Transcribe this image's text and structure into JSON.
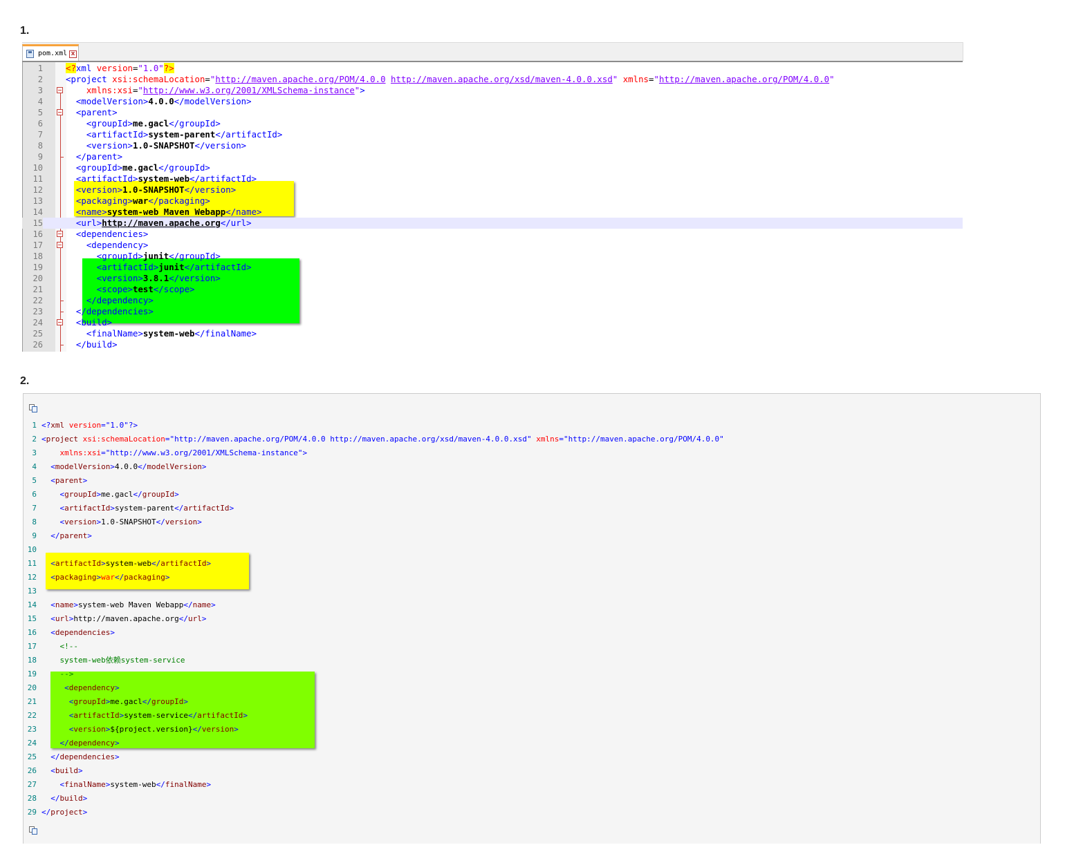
{
  "section1": {
    "heading": "1."
  },
  "section2": {
    "heading": "2."
  },
  "editor": {
    "tab_label": "pom.xml",
    "tab_close": "x",
    "line_numbers": [
      "1",
      "2",
      "3",
      "4",
      "5",
      "6",
      "7",
      "8",
      "9",
      "10",
      "11",
      "12",
      "13",
      "14",
      "15",
      "16",
      "17",
      "18",
      "19",
      "20",
      "21",
      "22",
      "23",
      "24",
      "25",
      "26"
    ],
    "current_line": 15,
    "lines": [
      [
        [
          "x-pi",
          "<?"
        ],
        [
          "x-tag",
          "xml "
        ],
        [
          "x-attr",
          "version"
        ],
        [
          "",
          "="
        ],
        [
          "x-val",
          "\"1.0\""
        ],
        [
          "x-pi",
          "?>"
        ]
      ],
      [
        [
          "x-tag",
          "<project "
        ],
        [
          "x-attr",
          "xsi:schemaLocation"
        ],
        [
          "",
          "="
        ],
        [
          "x-val",
          "\""
        ],
        [
          "x-url",
          "http://maven.apache.org/POM/4.0.0"
        ],
        [
          "x-val",
          " "
        ],
        [
          "x-url",
          "http://maven.apache.org/xsd/maven-4.0.0.xsd"
        ],
        [
          "x-val",
          "\" "
        ],
        [
          "x-attr",
          "xmlns"
        ],
        [
          "",
          "="
        ],
        [
          "x-val",
          "\""
        ],
        [
          "x-url",
          "http://maven.apache.org/POM/4.0.0"
        ],
        [
          "x-val",
          "\""
        ]
      ],
      [
        [
          "",
          "    "
        ],
        [
          "x-attr",
          "xmlns:xsi"
        ],
        [
          "",
          "="
        ],
        [
          "x-val",
          "\""
        ],
        [
          "x-url",
          "http://www.w3.org/2001/XMLSchema-instance"
        ],
        [
          "x-val",
          "\""
        ],
        [
          "x-tag",
          ">"
        ]
      ],
      [
        [
          "",
          "  "
        ],
        [
          "x-tag",
          "<modelVersion>"
        ],
        [
          "x-txt",
          "4.0.0"
        ],
        [
          "x-tag",
          "</modelVersion>"
        ]
      ],
      [
        [
          "",
          "  "
        ],
        [
          "x-tag",
          "<parent>"
        ]
      ],
      [
        [
          "",
          "    "
        ],
        [
          "x-tag",
          "<groupId>"
        ],
        [
          "x-txt",
          "me.gacl"
        ],
        [
          "x-tag",
          "</groupId>"
        ]
      ],
      [
        [
          "",
          "    "
        ],
        [
          "x-tag",
          "<artifactId>"
        ],
        [
          "x-txt",
          "system-parent"
        ],
        [
          "x-tag",
          "</artifactId>"
        ]
      ],
      [
        [
          "",
          "    "
        ],
        [
          "x-tag",
          "<version>"
        ],
        [
          "x-txt",
          "1.0-SNAPSHOT"
        ],
        [
          "x-tag",
          "</version>"
        ]
      ],
      [
        [
          "",
          "  "
        ],
        [
          "x-tag",
          "</parent>"
        ]
      ],
      [
        [
          "",
          "  "
        ],
        [
          "x-tag",
          "<groupId>"
        ],
        [
          "x-txt",
          "me.gacl"
        ],
        [
          "x-tag",
          "</groupId>"
        ]
      ],
      [
        [
          "",
          "  "
        ],
        [
          "x-tag",
          "<artifactId>"
        ],
        [
          "x-txt",
          "system-web"
        ],
        [
          "x-tag",
          "</artifactId>"
        ]
      ],
      [
        [
          "",
          "  "
        ],
        [
          "x-tag",
          "<version>"
        ],
        [
          "x-txt",
          "1.0-SNAPSHOT"
        ],
        [
          "x-tag",
          "</version>"
        ]
      ],
      [
        [
          "",
          "  "
        ],
        [
          "x-tag",
          "<packaging>"
        ],
        [
          "x-txt",
          "war"
        ],
        [
          "x-tag",
          "</packaging>"
        ]
      ],
      [
        [
          "",
          "  "
        ],
        [
          "x-tag",
          "<name>"
        ],
        [
          "x-txt",
          "system-web Maven Webapp"
        ],
        [
          "x-tag",
          "</name>"
        ]
      ],
      [
        [
          "",
          "  "
        ],
        [
          "x-tag",
          "<url>"
        ],
        [
          "x-link",
          "http://maven.apache.org"
        ],
        [
          "x-tag",
          "</url>"
        ]
      ],
      [
        [
          "",
          "  "
        ],
        [
          "x-tag",
          "<dependencies>"
        ]
      ],
      [
        [
          "",
          "    "
        ],
        [
          "x-tag",
          "<dependency>"
        ]
      ],
      [
        [
          "",
          "      "
        ],
        [
          "x-tag",
          "<groupId>"
        ],
        [
          "x-txt",
          "junit"
        ],
        [
          "x-tag",
          "</groupId>"
        ]
      ],
      [
        [
          "",
          "      "
        ],
        [
          "x-tag",
          "<artifactId>"
        ],
        [
          "x-txt",
          "junit"
        ],
        [
          "x-tag",
          "</artifactId>"
        ]
      ],
      [
        [
          "",
          "      "
        ],
        [
          "x-tag",
          "<version>"
        ],
        [
          "x-txt",
          "3.8.1"
        ],
        [
          "x-tag",
          "</version>"
        ]
      ],
      [
        [
          "",
          "      "
        ],
        [
          "x-tag",
          "<scope>"
        ],
        [
          "x-txt",
          "test"
        ],
        [
          "x-tag",
          "</scope>"
        ]
      ],
      [
        [
          "",
          "    "
        ],
        [
          "x-tag",
          "</dependency>"
        ]
      ],
      [
        [
          "",
          "  "
        ],
        [
          "x-tag",
          "</dependencies>"
        ]
      ],
      [
        [
          "",
          "  "
        ],
        [
          "x-tag",
          "<build>"
        ]
      ],
      [
        [
          "",
          "    "
        ],
        [
          "x-tag",
          "<finalName>"
        ],
        [
          "x-txt",
          "system-web"
        ],
        [
          "x-tag",
          "</finalName>"
        ]
      ],
      [
        [
          "",
          "  "
        ],
        [
          "x-tag",
          "</build>"
        ]
      ]
    ],
    "fold_open_lines": [
      3,
      5,
      16,
      17,
      24
    ],
    "fold_end_lines": [
      9,
      22,
      23,
      26
    ]
  },
  "blog": {
    "line_numbers": [
      "1",
      "2",
      "3",
      "4",
      "5",
      "6",
      "7",
      "8",
      "9",
      "10",
      "11",
      "12",
      "13",
      "14",
      "15",
      "16",
      "17",
      "18",
      "19",
      "20",
      "21",
      "22",
      "23",
      "24",
      "25",
      "26",
      "27",
      "28",
      "29"
    ],
    "lines": [
      [
        [
          "b-tag",
          "<?"
        ],
        [
          "b-name",
          "xml "
        ],
        [
          "b-attr",
          "version"
        ],
        [
          "b-tag",
          "=\"1.0\"?>"
        ]
      ],
      [
        [
          "b-tag",
          "<"
        ],
        [
          "b-name",
          "project "
        ],
        [
          "b-attr",
          "xsi:schemaLocation"
        ],
        [
          "b-tag",
          "=\"http://maven.apache.org/POM/4.0.0 http://maven.apache.org/xsd/maven-4.0.0.xsd\" "
        ],
        [
          "b-attr",
          "xmlns"
        ],
        [
          "b-tag",
          "=\"http://maven.apache.org/POM/4.0.0\""
        ]
      ],
      [
        [
          "",
          "    "
        ],
        [
          "b-attr",
          "xmlns:xsi"
        ],
        [
          "b-tag",
          "=\"http://www.w3.org/2001/XMLSchema-instance\">"
        ]
      ],
      [
        [
          "",
          "  "
        ],
        [
          "b-tag",
          "<"
        ],
        [
          "b-name",
          "modelVersion"
        ],
        [
          "b-tag",
          ">"
        ],
        [
          "",
          "4.0.0"
        ],
        [
          "b-tag",
          "</"
        ],
        [
          "b-name",
          "modelVersion"
        ],
        [
          "b-tag",
          ">"
        ]
      ],
      [
        [
          "",
          "  "
        ],
        [
          "b-tag",
          "<"
        ],
        [
          "b-name",
          "parent"
        ],
        [
          "b-tag",
          ">"
        ]
      ],
      [
        [
          "",
          "    "
        ],
        [
          "b-tag",
          "<"
        ],
        [
          "b-name",
          "groupId"
        ],
        [
          "b-tag",
          ">"
        ],
        [
          "",
          "me.gacl"
        ],
        [
          "b-tag",
          "</"
        ],
        [
          "b-name",
          "groupId"
        ],
        [
          "b-tag",
          ">"
        ]
      ],
      [
        [
          "",
          "    "
        ],
        [
          "b-tag",
          "<"
        ],
        [
          "b-name",
          "artifactId"
        ],
        [
          "b-tag",
          ">"
        ],
        [
          "",
          "system-parent"
        ],
        [
          "b-tag",
          "</"
        ],
        [
          "b-name",
          "artifactId"
        ],
        [
          "b-tag",
          ">"
        ]
      ],
      [
        [
          "",
          "    "
        ],
        [
          "b-tag",
          "<"
        ],
        [
          "b-name",
          "version"
        ],
        [
          "b-tag",
          ">"
        ],
        [
          "",
          "1.0-SNAPSHOT"
        ],
        [
          "b-tag",
          "</"
        ],
        [
          "b-name",
          "version"
        ],
        [
          "b-tag",
          ">"
        ]
      ],
      [
        [
          "",
          "  "
        ],
        [
          "b-tag",
          "</"
        ],
        [
          "b-name",
          "parent"
        ],
        [
          "b-tag",
          ">"
        ]
      ],
      [],
      [
        [
          "",
          "  "
        ],
        [
          "b-tag",
          "<"
        ],
        [
          "b-name",
          "artifactId"
        ],
        [
          "b-tag",
          ">"
        ],
        [
          "",
          "system-web"
        ],
        [
          "b-tag",
          "</"
        ],
        [
          "b-name",
          "artifactId"
        ],
        [
          "b-tag",
          ">"
        ]
      ],
      [
        [
          "",
          "  "
        ],
        [
          "b-tag",
          "<"
        ],
        [
          "b-name",
          "packaging"
        ],
        [
          "b-tag",
          ">"
        ],
        [
          "b-warm",
          "war"
        ],
        [
          "b-tag",
          "</"
        ],
        [
          "b-name",
          "packaging"
        ],
        [
          "b-tag",
          ">"
        ]
      ],
      [],
      [
        [
          "",
          "  "
        ],
        [
          "b-tag",
          "<"
        ],
        [
          "b-name",
          "name"
        ],
        [
          "b-tag",
          ">"
        ],
        [
          "",
          "system-web Maven Webapp"
        ],
        [
          "b-tag",
          "</"
        ],
        [
          "b-name",
          "name"
        ],
        [
          "b-tag",
          ">"
        ]
      ],
      [
        [
          "",
          "  "
        ],
        [
          "b-tag",
          "<"
        ],
        [
          "b-name",
          "url"
        ],
        [
          "b-tag",
          ">"
        ],
        [
          "",
          "http://maven.apache.org"
        ],
        [
          "b-tag",
          "</"
        ],
        [
          "b-name",
          "url"
        ],
        [
          "b-tag",
          ">"
        ]
      ],
      [
        [
          "",
          "  "
        ],
        [
          "b-tag",
          "<"
        ],
        [
          "b-name",
          "dependencies"
        ],
        [
          "b-tag",
          ">"
        ]
      ],
      [
        [
          "",
          "    "
        ],
        [
          "b-cm",
          "<!--"
        ]
      ],
      [
        [
          "",
          "    "
        ],
        [
          "b-cm",
          "system-web依赖system-service"
        ]
      ],
      [
        [
          "",
          "    "
        ],
        [
          "b-cm",
          "-->"
        ]
      ],
      [
        [
          "",
          "     "
        ],
        [
          "b-tag",
          "<"
        ],
        [
          "b-name",
          "dependency"
        ],
        [
          "b-tag",
          ">"
        ]
      ],
      [
        [
          "",
          "      "
        ],
        [
          "b-tag",
          "<"
        ],
        [
          "b-name",
          "groupId"
        ],
        [
          "b-tag",
          ">"
        ],
        [
          "",
          "me.gacl"
        ],
        [
          "b-tag",
          "</"
        ],
        [
          "b-name",
          "groupId"
        ],
        [
          "b-tag",
          ">"
        ]
      ],
      [
        [
          "",
          "      "
        ],
        [
          "b-tag",
          "<"
        ],
        [
          "b-name",
          "artifactId"
        ],
        [
          "b-tag",
          ">"
        ],
        [
          "",
          "system-service"
        ],
        [
          "b-tag",
          "</"
        ],
        [
          "b-name",
          "artifactId"
        ],
        [
          "b-tag",
          ">"
        ]
      ],
      [
        [
          "",
          "      "
        ],
        [
          "b-tag",
          "<"
        ],
        [
          "b-name",
          "version"
        ],
        [
          "b-tag",
          ">"
        ],
        [
          "",
          "${project.version}"
        ],
        [
          "b-tag",
          "</"
        ],
        [
          "b-name",
          "version"
        ],
        [
          "b-tag",
          ">"
        ]
      ],
      [
        [
          "",
          "    "
        ],
        [
          "b-tag",
          "</"
        ],
        [
          "b-name",
          "dependency"
        ],
        [
          "b-tag",
          ">"
        ]
      ],
      [
        [
          "",
          "  "
        ],
        [
          "b-tag",
          "</"
        ],
        [
          "b-name",
          "dependencies"
        ],
        [
          "b-tag",
          ">"
        ]
      ],
      [
        [
          "",
          "  "
        ],
        [
          "b-tag",
          "<"
        ],
        [
          "b-name",
          "build"
        ],
        [
          "b-tag",
          ">"
        ]
      ],
      [
        [
          "",
          "    "
        ],
        [
          "b-tag",
          "<"
        ],
        [
          "b-name",
          "finalName"
        ],
        [
          "b-tag",
          ">"
        ],
        [
          "",
          "system-web"
        ],
        [
          "b-tag",
          "</"
        ],
        [
          "b-name",
          "finalName"
        ],
        [
          "b-tag",
          ">"
        ]
      ],
      [
        [
          "",
          "  "
        ],
        [
          "b-tag",
          "</"
        ],
        [
          "b-name",
          "build"
        ],
        [
          "b-tag",
          ">"
        ]
      ],
      [
        [
          "b-tag",
          "</"
        ],
        [
          "b-name",
          "project"
        ],
        [
          "b-tag",
          ">"
        ]
      ]
    ],
    "copy_icon_top": "copy-code-icon",
    "copy_icon_bottom": "copy-code-icon"
  },
  "colors": {
    "highlight_yellow": "#ffff00",
    "highlight_green": "#00ff00",
    "highlight_lime": "#80ff00",
    "tab_accent": "#f7a23b",
    "current_line": "#e8e8ff"
  }
}
